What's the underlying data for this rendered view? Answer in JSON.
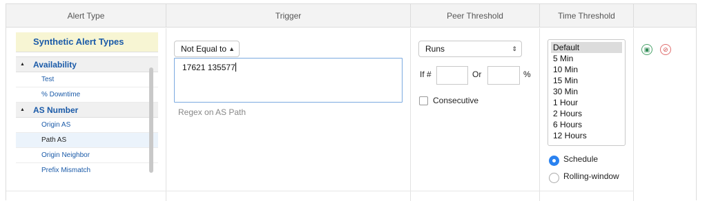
{
  "columns": {
    "alert_type": "Alert Type",
    "trigger": "Trigger",
    "peer_threshold": "Peer Threshold",
    "time_threshold": "Time Threshold"
  },
  "alert_types": {
    "title": "Synthetic Alert Types",
    "groups": [
      {
        "label": "Availability",
        "items": [
          "Test",
          "% Downtime"
        ]
      },
      {
        "label": "AS Number",
        "items": [
          "Origin AS",
          "Path AS",
          "Origin Neighbor",
          "Prefix Mismatch"
        ]
      }
    ],
    "selected_item": "Path AS"
  },
  "trigger": {
    "operator": "Not Equal to",
    "value": "17621 135577",
    "hint": "Regex on AS Path"
  },
  "peer_threshold": {
    "metric": "Runs",
    "if_label": "If #",
    "or_label": "Or",
    "percent_label": "%",
    "consecutive_label": "Consecutive"
  },
  "time_threshold": {
    "options": [
      "Default",
      "5 Min",
      "10 Min",
      "15 Min",
      "30 Min",
      "1 Hour",
      "2 Hours",
      "6 Hours",
      "12 Hours"
    ],
    "selected": "Default",
    "mode_options": [
      "Schedule",
      "Rolling-window"
    ],
    "selected_mode": "Schedule"
  },
  "actions": {
    "save_icon": "save-icon",
    "cancel_icon": "cancel-icon",
    "colors": {
      "save": "#4aa36a",
      "cancel": "#e06d6d"
    }
  }
}
